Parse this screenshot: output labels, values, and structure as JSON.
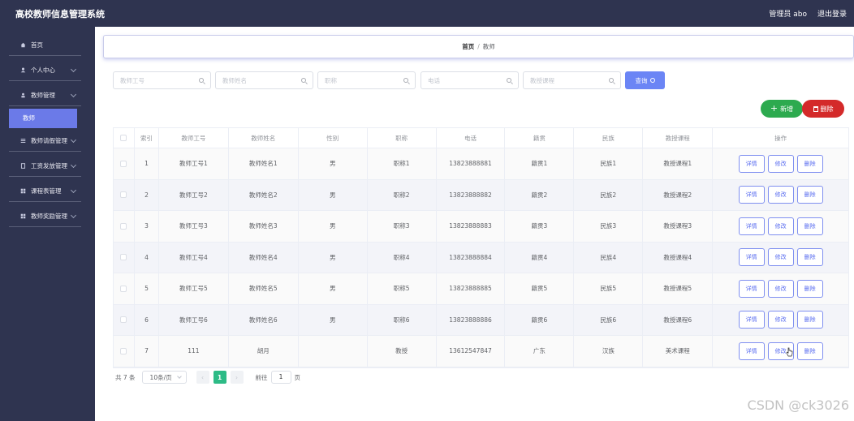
{
  "header": {
    "title": "高校教师信息管理系统",
    "admin": "管理员 abo",
    "logout": "退出登录"
  },
  "sidebar": {
    "items": [
      {
        "label": "首页",
        "icon": "home-icon"
      },
      {
        "label": "个人中心",
        "icon": "user-icon"
      },
      {
        "label": "教师管理",
        "icon": "teacher-icon"
      },
      {
        "label": "教师请假管理",
        "icon": "menu-icon"
      },
      {
        "label": "工资发放管理",
        "icon": "document-icon"
      },
      {
        "label": "课程表管理",
        "icon": "grid-icon"
      },
      {
        "label": "教师奖励管理",
        "icon": "grid-icon"
      }
    ],
    "active_sub": "教师"
  },
  "breadcrumb": {
    "home": "首页",
    "sep": "/",
    "current": "教师"
  },
  "search": {
    "placeholders": [
      "教师工号",
      "教师姓名",
      "职称",
      "电话",
      "教授课程"
    ],
    "query_label": "查询"
  },
  "actions": {
    "add_label": "新增",
    "delete_label": "删除"
  },
  "table": {
    "headers": [
      "索引",
      "教师工号",
      "教师姓名",
      "性别",
      "职称",
      "电话",
      "籍贯",
      "民族",
      "教授课程",
      "操作"
    ],
    "rows": [
      [
        "1",
        "教师工号1",
        "教师姓名1",
        "男",
        "职称1",
        "13823888881",
        "籍贯1",
        "民族1",
        "教授课程1"
      ],
      [
        "2",
        "教师工号2",
        "教师姓名2",
        "男",
        "职称2",
        "13823888882",
        "籍贯2",
        "民族2",
        "教授课程2"
      ],
      [
        "3",
        "教师工号3",
        "教师姓名3",
        "男",
        "职称3",
        "13823888883",
        "籍贯3",
        "民族3",
        "教授课程3"
      ],
      [
        "4",
        "教师工号4",
        "教师姓名4",
        "男",
        "职称4",
        "13823888884",
        "籍贯4",
        "民族4",
        "教授课程4"
      ],
      [
        "5",
        "教师工号5",
        "教师姓名5",
        "男",
        "职称5",
        "13823888885",
        "籍贯5",
        "民族5",
        "教授课程5"
      ],
      [
        "6",
        "教师工号6",
        "教师姓名6",
        "男",
        "职称6",
        "13823888886",
        "籍贯6",
        "民族6",
        "教授课程6"
      ],
      [
        "7",
        "111",
        "胡月",
        "",
        "教授",
        "13612547847",
        "广东",
        "汉族",
        "美术课程"
      ]
    ],
    "row_actions": [
      "详情",
      "修改",
      "删除"
    ]
  },
  "pagination": {
    "total": "共 7 条",
    "page_size": "10条/页",
    "prev": "‹",
    "next": "›",
    "current_page": "1",
    "goto_prefix": "前往",
    "goto_value": "1",
    "goto_suffix": "页"
  },
  "watermark": "CSDN @ck3026",
  "colors": {
    "sidebar_bg": "#2f3450",
    "accent": "#6b7ae8",
    "add": "#2daa4f",
    "delete": "#d42a2a",
    "page_active": "#2dbb86"
  }
}
